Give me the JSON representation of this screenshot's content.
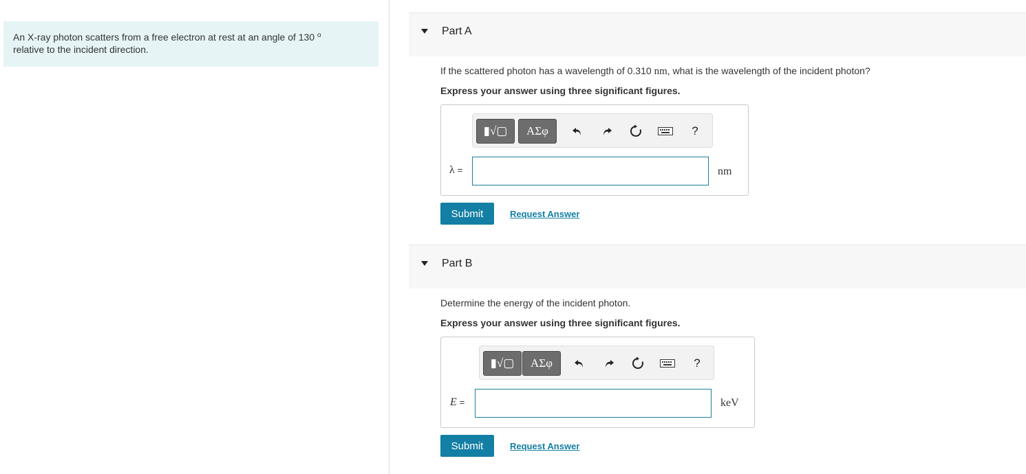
{
  "intro": {
    "text_line1": "An X-ray photon scatters from a free electron at rest at an angle of 130",
    "degree": "o",
    "text_line2": "relative to the incident direction."
  },
  "parts": [
    {
      "title": "Part A",
      "question_prefix": "If the scattered photon has a wavelength of 0.310 ",
      "question_unit": "nm",
      "question_suffix": ", what is the wavelength of the incident photon?",
      "instruction": "Express your answer using three significant figures.",
      "variable": "λ",
      "equals": "=",
      "input_value": "",
      "unit": "nm",
      "toolbar": {
        "templates_label": "▮√▢",
        "symbols_label": "ΑΣφ",
        "help_label": "?"
      },
      "submit_label": "Submit",
      "request_label": "Request Answer"
    },
    {
      "title": "Part B",
      "question": "Determine the energy of the incident photon.",
      "instruction": "Express your answer using three significant figures.",
      "variable": "E",
      "equals": "=",
      "input_value": "",
      "unit": "keV",
      "toolbar": {
        "templates_label": "▮√▢",
        "symbols_label": "ΑΣφ",
        "help_label": "?"
      },
      "submit_label": "Submit",
      "request_label": "Request Answer"
    }
  ],
  "icons": [
    "undo-icon",
    "redo-icon",
    "reset-icon",
    "keyboard-icon",
    "help-icon",
    "caret-down-icon"
  ],
  "colors": {
    "intro_bg": "#e6f4f6",
    "submit_bg": "#147fa4",
    "link": "#147fa4",
    "input_border": "#1b7d9a"
  }
}
